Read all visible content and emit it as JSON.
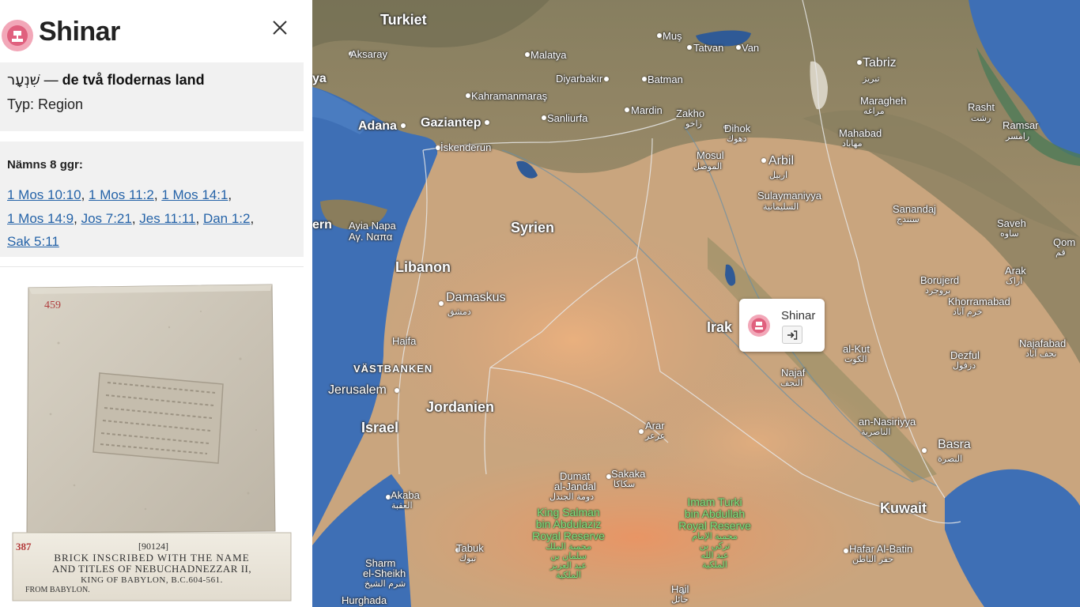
{
  "sidebar": {
    "title": "Shinar",
    "hebrew": "שִׁנְעָר",
    "separator": " — ",
    "meaning": "de två flodernas land",
    "type_line": "Typ: Region",
    "mentions_label": "Nämns 8 ggr:",
    "references": [
      "1 Mos 10:10",
      "1 Mos 11:2",
      "1 Mos 14:1",
      "1 Mos 14:9",
      "Jos 7:21",
      "Jes 11:11",
      "Dan 1:2",
      "Sak 5:11"
    ],
    "photo": {
      "corner_number_top": "459",
      "corner_number_label": "387",
      "catalog": "[90124]",
      "caption_line1": "BRICK INSCRIBED WITH THE NAME",
      "caption_line2": "AND TITLES OF NEBUCHADNEZZAR II,",
      "caption_line3": "KING OF BABYLON, B.C.604-561.",
      "caption_line4": "FROM BABYLON."
    }
  },
  "map": {
    "countries": [
      "Turkiet",
      "Syrien",
      "Libanon",
      "Irak",
      "Jordanien",
      "Israel",
      "Kuwait",
      "VÄSTBANKEN",
      "ern"
    ],
    "cities": {
      "aksaray": "Aksaray",
      "malatya": "Malatya",
      "mus": "Muş",
      "tatvan": "Tatvan",
      "van": "Van",
      "tabriz": "Tabriz",
      "tabriz_ar": "تبريز",
      "rasht": "Rasht",
      "rasht_ar": "رشت",
      "diyarbakir": "Diyarbakır",
      "batman": "Batman",
      "kahramanmaras": "Kahramanmaraş",
      "maragheh": "Maragheh",
      "maragheh_ar": "مراغه",
      "ramsar": "Ramsar",
      "ramsar_ar": "رامسر",
      "adana": "Adana",
      "gaziantep": "Gaziantep",
      "sanliurfa": "Sanliurfa",
      "mardin": "Mardin",
      "zakho": "Zakho",
      "zakho_ar": "زاخو",
      "dihok": "Dihok",
      "dihok_ar": "دهوك",
      "mahabad": "Mahabad",
      "mahabad_ar": "مهاباد",
      "iskenderun": "İskenderun",
      "mosul": "Mosul",
      "mosul_ar": "الموصل",
      "arbil": "Arbil",
      "arbil_ar": "اربيل",
      "sulaymaniyya": "Sulaymaniyya",
      "sulaymaniyya_ar": "السليمانية",
      "sanandaj": "Sanandaj",
      "sanandaj_ar": "سنندج",
      "saveh": "Saveh",
      "saveh_ar": "ساوه",
      "qom": "Qom",
      "qom_ar": "قم",
      "ayia_napa": "Ayia Napa",
      "ayia_napa_gr": "Αγ. Ναπα",
      "arak": "Arak",
      "arak_ar": "اراک",
      "borujerd": "Borujerd",
      "borujerd_ar": "بروجرد",
      "damaskus": "Damaskus",
      "damaskus_ar": "دمشق",
      "khorramabad": "Khorramabad",
      "khorramabad_ar": "خرم آباد",
      "haifa": "Haifa",
      "alkut": "al-Kut",
      "alkut_ar": "الكوت",
      "najafabad": "Najafabad",
      "najafabad_ar": "نجف آباد",
      "dezful": "Dezful",
      "dezful_ar": "دزفول",
      "najaf": "Najaf",
      "najaf_ar": "النجف",
      "jerusalem": "Jerusalem",
      "arar": "Arar",
      "arar_ar": "عرعر",
      "annasiriyya": "an-Nasiriyya",
      "annasiriyya_ar": "الناصرية",
      "basra": "Basra",
      "basra_ar": "البصرة",
      "dumat": "Dumat",
      "aljandal": "al-Jandal",
      "dumat_ar": "دومة الجندل",
      "sakaka": "Sakaka",
      "sakaka_ar": "سكاكا",
      "akaba": "Akaba",
      "akaba_ar": "العقبة",
      "tabuk": "Tabuk",
      "tabuk_ar": "تبوك",
      "hafar": "Hafar Al-Batin",
      "hafar_ar": "حفر الباطن",
      "sharm": "Sharm",
      "elsheikh": "el-Sheikh",
      "sharm_ar": "شرم الشيخ",
      "hail": "Hail",
      "hail_ar": "حائل",
      "hurghada": "Hurghada",
      "ya": "ya"
    },
    "reserves": {
      "king_salman": [
        "King Salman",
        "bin Abdulaziz",
        "Royal Reserve",
        "محمية الملك",
        "سلمان بن",
        "عبد العزيز",
        "الملكية"
      ],
      "imam_turki": [
        "Imam Turki",
        "bin Abdullah",
        "Royal Reserve",
        "محمية الإمام",
        "تركي بن",
        "عبد الله",
        "الملكية"
      ]
    },
    "popup": {
      "name": "Shinar"
    }
  },
  "colors": {
    "pin": "#f2a7b8",
    "pin_dark": "#e0607e",
    "link": "#2563a8",
    "card": "#f1f1f1",
    "sea": "#3e6fb5"
  }
}
